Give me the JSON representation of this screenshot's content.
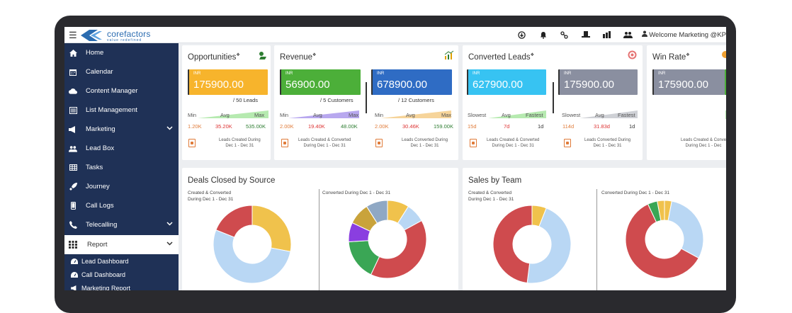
{
  "app": {
    "logo_text": "corefactors",
    "logo_tagline": "value redefined",
    "welcome": "Welcome Marketing @KP"
  },
  "top_icons": [
    "download-icon",
    "bell-icon",
    "link-icon",
    "hat-icon",
    "chart-icon",
    "users-icon"
  ],
  "sidebar": {
    "items": [
      {
        "label": "Home",
        "icon": "home-icon"
      },
      {
        "label": "Calendar",
        "icon": "calendar-icon"
      },
      {
        "label": "Content Manager",
        "icon": "cloud-icon"
      },
      {
        "label": "List Management",
        "icon": "list-icon"
      },
      {
        "label": "Marketing",
        "icon": "megaphone-icon",
        "has_children": true
      },
      {
        "label": "Lead Box",
        "icon": "people-icon"
      },
      {
        "label": "Tasks",
        "icon": "table-icon"
      },
      {
        "label": "Journey",
        "icon": "rocket-icon"
      },
      {
        "label": "Call Logs",
        "icon": "phone-icon"
      },
      {
        "label": "Telecalling",
        "icon": "telephone-icon",
        "has_children": true
      },
      {
        "label": "Report",
        "icon": "grid-icon",
        "has_children": true,
        "active": true
      }
    ],
    "sub_items": [
      {
        "label": "Lead Dashboard",
        "icon": "dashboard-icon"
      },
      {
        "label": "Call Dashboard",
        "icon": "dashboard-icon"
      },
      {
        "label": "Marketing Report",
        "icon": "megaphone-icon"
      }
    ]
  },
  "kpis": {
    "opportunities": {
      "title": "Opportunities",
      "currency": "INR",
      "value": "175900.00",
      "sub": "/ 50 Leads",
      "labels": [
        "Min",
        "Avg",
        "Max"
      ],
      "values": [
        "1.20K",
        "35.20K",
        "535.00K"
      ],
      "footer": [
        "Leads Created During",
        "Dec 1 - Dec 31"
      ]
    },
    "revenue": {
      "title": "Revenue",
      "left": {
        "currency": "INR",
        "value": "56900.00",
        "sub": "/ 5 Customers"
      },
      "right": {
        "currency": "INR",
        "value": "678900.00",
        "sub": "/ 12 Customers"
      },
      "labels_left": [
        "Min",
        "Avg",
        "Max"
      ],
      "values_left": [
        "2.00K",
        "19.40K",
        "48.00K"
      ],
      "labels_right": [
        "Min",
        "Avg",
        "Max"
      ],
      "values_right": [
        "2.00K",
        "30.46K",
        "159.00K"
      ],
      "footer_left": [
        "Leads Created & Converted",
        "During Dec 1 - Dec 31"
      ],
      "footer_right": [
        "Leads Converted During",
        "Dec 1 - Dec 31"
      ]
    },
    "converted": {
      "title": "Converted Leads",
      "left": {
        "currency": "INR",
        "value": "627900.00"
      },
      "right": {
        "currency": "INR",
        "value": "175900.00"
      },
      "labels_left": [
        "Slowest",
        "Avg",
        "Fastest"
      ],
      "values_left": [
        "15d",
        "7d",
        "1d"
      ],
      "labels_right": [
        "Slowest",
        "Avg",
        "Fastest"
      ],
      "values_right": [
        "114d",
        "31.83d",
        "1d"
      ],
      "footer_left": [
        "Leads Created & Converted",
        "During Dec 1 - Dec 31"
      ],
      "footer_right": [
        "Leads Converted During",
        "Dec 1 - Dec 31"
      ]
    },
    "winrate": {
      "title": "Win Rate",
      "currency": "INR",
      "value": "175900.00",
      "footer": [
        "Leads Created & Conve",
        "During Dec 1 - Dec"
      ]
    }
  },
  "charts": {
    "deals_title": "Deals Closed by Source",
    "sales_title": "Sales by Team",
    "deals_left_label": [
      "Created & Converted",
      "During Dec 1 - Dec 31"
    ],
    "deals_right_label": "Converted During Dec 1 - Dec 31",
    "sales_left_label": [
      "Created & Converted",
      "During Dec 1 - Dec 31"
    ],
    "sales_right_label": "Converted During Dec 1 - Dec 31"
  },
  "chart_data": [
    {
      "type": "pie",
      "name": "deals-left",
      "values": [
        28,
        53,
        19
      ],
      "colors": [
        "#f0c24c",
        "#b9d7f4",
        "#cf4b4e"
      ]
    },
    {
      "type": "pie",
      "name": "deals-right",
      "values": [
        9,
        8,
        40,
        17,
        8,
        9,
        9
      ],
      "colors": [
        "#f0c24c",
        "#b9d7f4",
        "#cf4b4e",
        "#3aa655",
        "#8a3ee0",
        "#c9a33b",
        "#8fa8c4"
      ]
    },
    {
      "type": "pie",
      "name": "sales-left",
      "values": [
        6,
        46,
        48
      ],
      "colors": [
        "#f0c24c",
        "#b9d7f4",
        "#cf4b4e"
      ]
    },
    {
      "type": "pie",
      "name": "sales-right",
      "values": [
        3,
        30,
        60,
        4,
        3
      ],
      "colors": [
        "#f0c24c",
        "#b9d7f4",
        "#cf4b4e",
        "#3aa655",
        "#f0c24c"
      ]
    }
  ]
}
